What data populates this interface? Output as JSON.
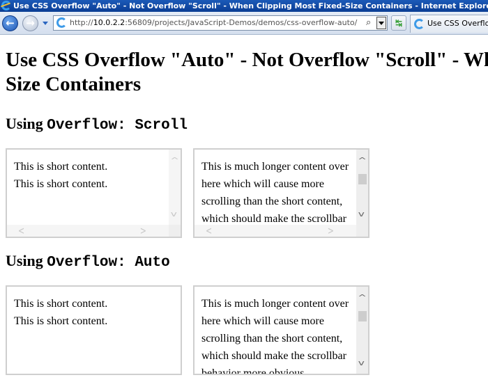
{
  "window": {
    "title": "Use CSS Overflow \"Auto\" - Not Overflow \"Scroll\" - When Clipping Most Fixed-Size Containers - Internet Explorer"
  },
  "toolbar": {
    "back_icon": "back-arrow-icon",
    "forward_icon": "forward-arrow-icon",
    "url_prefix": "http://",
    "url_host": "10.0.2.2",
    "url_rest": ":56809/projects/JavaScript-Demos/demos/css-overflow-auto/",
    "search_icon": "⌕",
    "refresh_icon": "↹",
    "tab_label": "Use CSS Overflow \"Auto\" - Not Overflow \"Scroll\""
  },
  "page": {
    "title_line1": "Use CSS Overflow \"Auto\" - Not Overflow \"Scroll\" - When Clipping Most Fixed-",
    "title_line2": "Size Containers",
    "section_scroll": {
      "prefix": "Using ",
      "code": "Overflow: Scroll"
    },
    "section_auto": {
      "prefix": "Using ",
      "code": "Overflow: Auto"
    },
    "short_content": [
      "This is short content.",
      "This is short content."
    ],
    "long_content": "This is much longer content over here which will cause more scrolling than the short content, which should make the scrollbar behavior more obvious."
  },
  "scrollbar_glyphs": {
    "up": "^",
    "down": "v",
    "left": "<",
    "right": ">"
  }
}
